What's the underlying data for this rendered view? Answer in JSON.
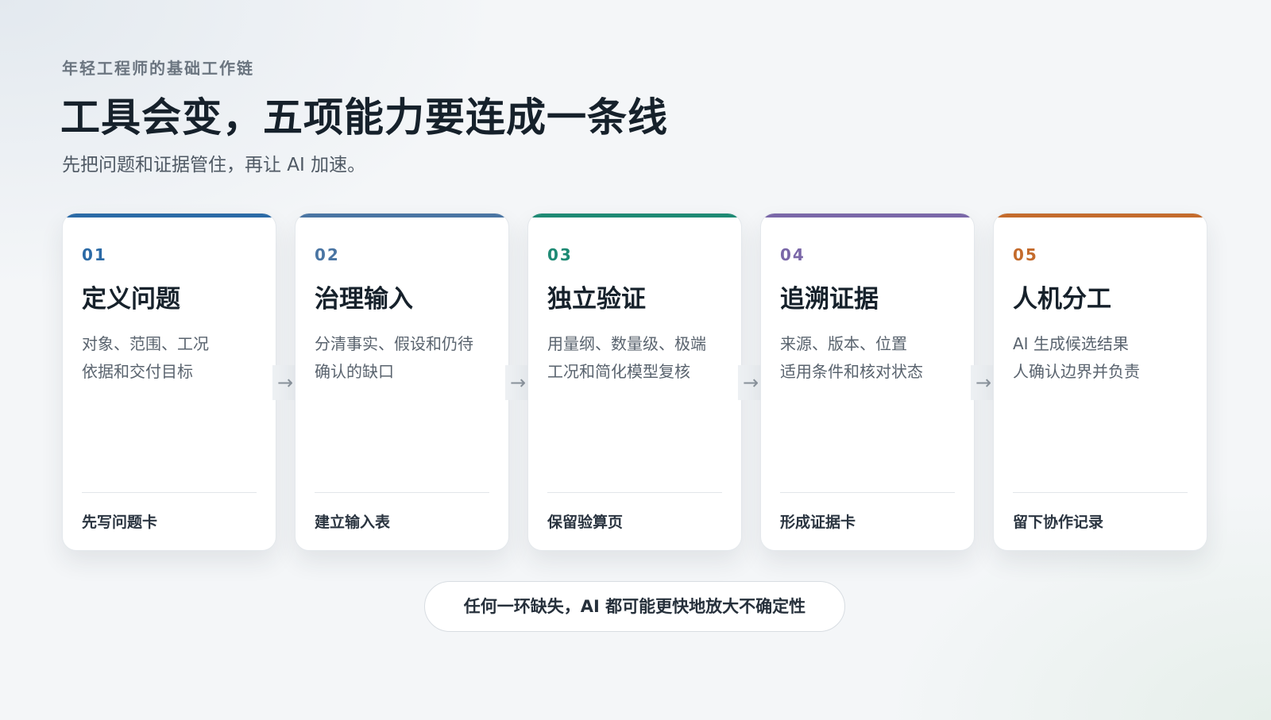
{
  "header": {
    "eyebrow": "年轻工程师的基础工作链",
    "title": "工具会变，五项能力要连成一条线",
    "subtitle": "先把问题和证据管住，再让 AI 加速。"
  },
  "arrow_glyph": "→",
  "cards": [
    {
      "num": "01",
      "title": "定义问题",
      "lines": [
        "对象、范围、工况",
        "依据和交付目标"
      ],
      "action": "先写问题卡",
      "color": "#2b6aa6"
    },
    {
      "num": "02",
      "title": "治理输入",
      "lines": [
        "分清事实、假设和仍待",
        "确认的缺口"
      ],
      "action": "建立输入表",
      "color": "#4a75a3"
    },
    {
      "num": "03",
      "title": "独立验证",
      "lines": [
        "用量纲、数量级、极端",
        "工况和简化模型复核"
      ],
      "action": "保留验算页",
      "color": "#1e8a74"
    },
    {
      "num": "04",
      "title": "追溯证据",
      "lines": [
        "来源、版本、位置",
        "适用条件和核对状态"
      ],
      "action": "形成证据卡",
      "color": "#7a67a8"
    },
    {
      "num": "05",
      "title": "人机分工",
      "lines": [
        "AI 生成候选结果",
        "人确认边界并负责"
      ],
      "action": "留下协作记录",
      "color": "#c46b2c"
    }
  ],
  "footer": {
    "note": "任何一环缺失，AI 都可能更快地放大不确定性"
  }
}
